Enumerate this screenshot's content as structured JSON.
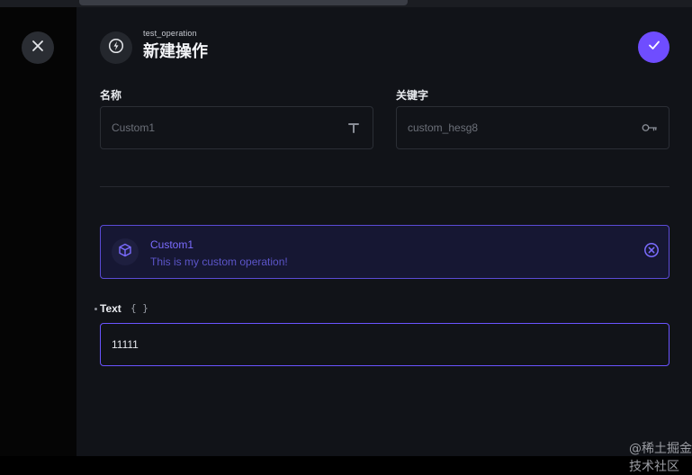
{
  "header": {
    "subtitle": "test_operation",
    "title": "新建操作"
  },
  "fields": {
    "name": {
      "label": "名称",
      "placeholder": "Custom1",
      "value": ""
    },
    "key": {
      "label": "关键字",
      "placeholder": "custom_hesg8",
      "value": ""
    }
  },
  "operation": {
    "name": "Custom1",
    "description": "This is my custom operation!"
  },
  "text_field": {
    "label": "Text",
    "braces": "{ }",
    "value": "11111"
  },
  "watermark": "@稀土掘金技术社区",
  "colors": {
    "accent": "#6f4dff",
    "card_bg": "#161733",
    "panel_bg": "#111318"
  },
  "icons": {
    "close": "close-icon",
    "operation": "bolt-circle-icon",
    "confirm": "check-icon",
    "name_field": "text-type-icon",
    "key_field": "key-icon",
    "operation_card": "cube-icon",
    "remove": "x-circle-icon"
  }
}
